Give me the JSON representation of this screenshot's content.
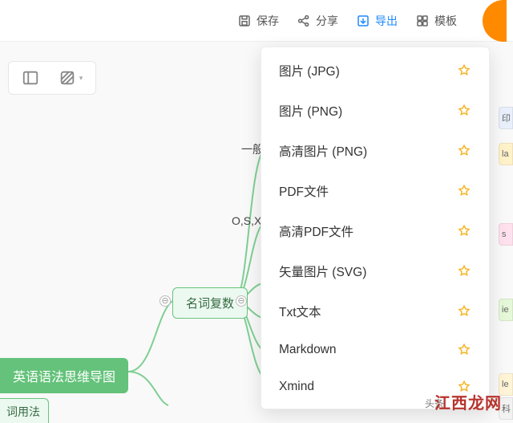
{
  "topbar": {
    "save": "保存",
    "share": "分享",
    "export": "导出",
    "template": "模板"
  },
  "export_menu": {
    "items": [
      {
        "label": "图片 (JPG)",
        "premium": true
      },
      {
        "label": "图片 (PNG)",
        "premium": true
      },
      {
        "label": "高清图片 (PNG)",
        "premium": true
      },
      {
        "label": "PDF文件",
        "premium": true
      },
      {
        "label": "高清PDF文件",
        "premium": true
      },
      {
        "label": "矢量图片 (SVG)",
        "premium": true
      },
      {
        "label": "Txt文本",
        "premium": true
      },
      {
        "label": "Markdown",
        "premium": true
      },
      {
        "label": "Xmind",
        "premium": true
      }
    ]
  },
  "mindmap": {
    "root": "英语语法思维导图",
    "branch_a": "名词复数",
    "leaf_partial": "词用法",
    "child_1": "一般",
    "child_2": "O,S,X"
  },
  "edge_tabs": {
    "t0": "印",
    "t1": "la",
    "t2": "s",
    "t3": "ie",
    "t4": "le",
    "t5": "科"
  },
  "watermark": {
    "main": "江西龙网",
    "sub": "头条"
  }
}
